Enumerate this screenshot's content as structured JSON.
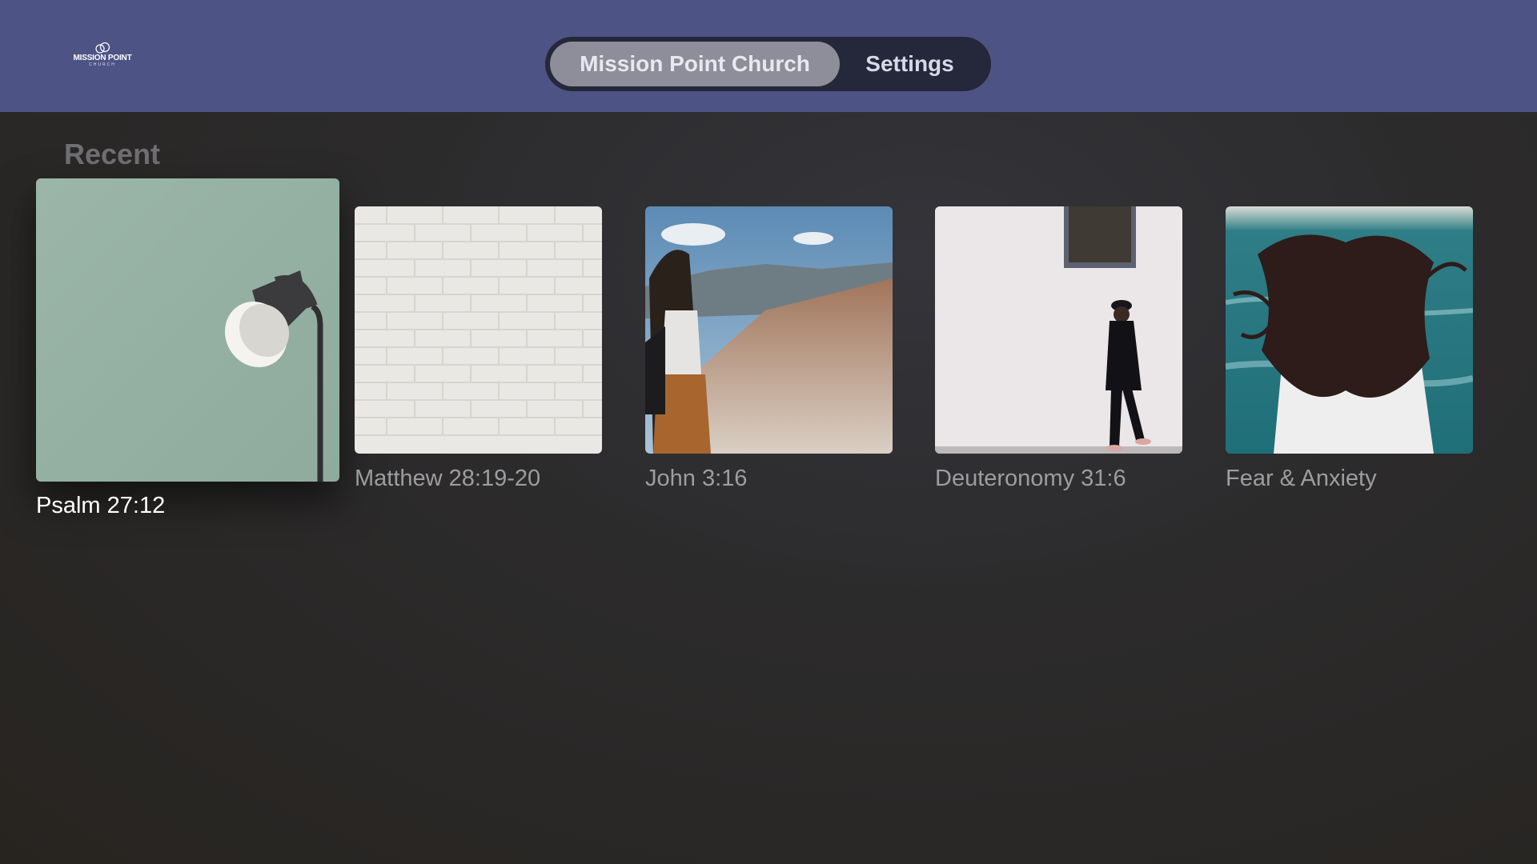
{
  "header": {
    "logo": {
      "name": "MISSION POINT",
      "sub": "CHURCH"
    },
    "tabs": [
      {
        "label": "Mission Point Church",
        "active": true
      },
      {
        "label": "Settings",
        "active": false
      }
    ]
  },
  "recent": {
    "title": "Recent",
    "items": [
      {
        "label": "Psalm 27:12",
        "image": "lamp-on-green-wall",
        "focused": true
      },
      {
        "label": "Matthew 28:19-20",
        "image": "white-brick-wall"
      },
      {
        "label": "John 3:16",
        "image": "woman-hiking-mountains"
      },
      {
        "label": "Deuteronomy 31:6",
        "image": "man-walking-by-white-wall"
      },
      {
        "label": "Fear & Anxiety",
        "image": "woman-hair-blowing-by-sea"
      }
    ]
  },
  "colors": {
    "topbar": "#4e5385",
    "tabbar_bg": "#25273a",
    "active_tab": "#8d8e99",
    "background": "#2c2b2c"
  }
}
